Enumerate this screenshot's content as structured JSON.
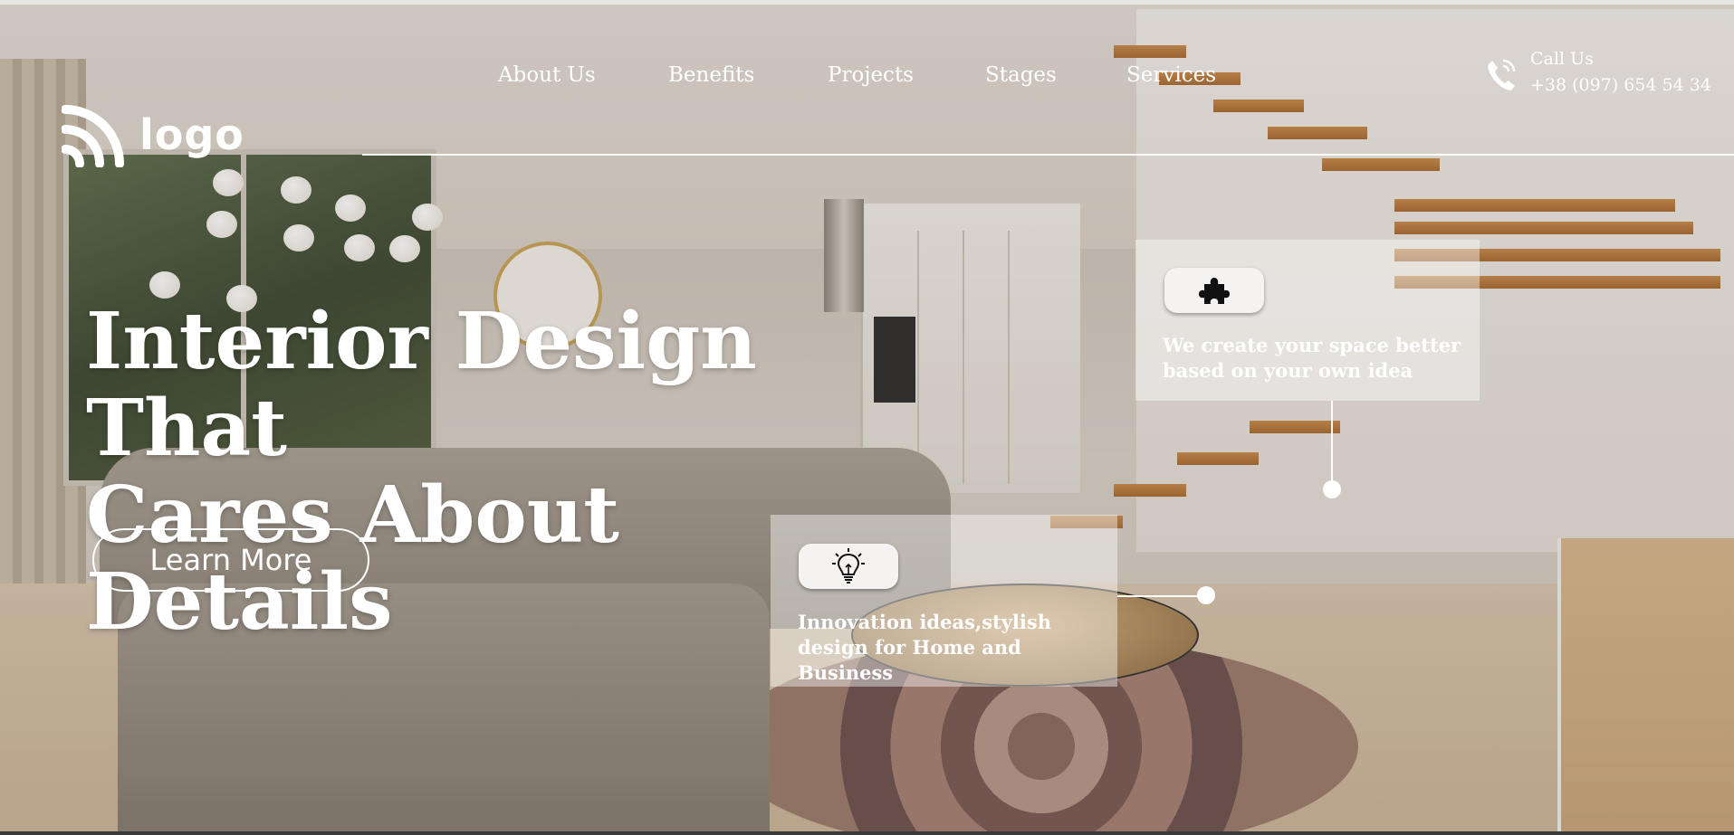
{
  "header": {
    "logo_text": "logo",
    "nav": [
      {
        "label": "About Us"
      },
      {
        "label": "Benefits"
      },
      {
        "label": "Projects"
      },
      {
        "label": "Stages"
      },
      {
        "label": "Services"
      }
    ],
    "contact": {
      "label": "Call Us",
      "phone": "+38 (097) 654 54 34"
    }
  },
  "hero": {
    "title_line1": "Interior Design That",
    "title_line2": "Cares About Details",
    "cta_label": "Learn More"
  },
  "cards": [
    {
      "icon": "puzzle-icon",
      "text": "We create your space better based on your own idea"
    },
    {
      "icon": "lightbulb-icon",
      "text": "Innovation ideas,stylish design for Home and Business"
    }
  ]
}
